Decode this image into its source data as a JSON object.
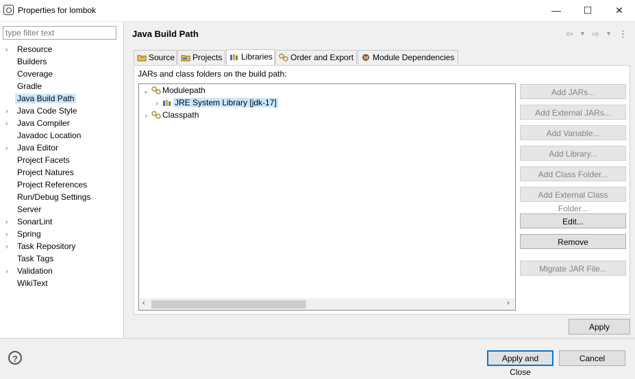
{
  "window": {
    "title": "Properties for lombok",
    "minimize_glyph": "—",
    "maximize_glyph": "☐",
    "close_glyph": "✕"
  },
  "filter": {
    "placeholder": "type filter text",
    "value": ""
  },
  "nav": {
    "items": [
      {
        "label": "Resource",
        "expandable": true
      },
      {
        "label": "Builders",
        "expandable": false
      },
      {
        "label": "Coverage",
        "expandable": false
      },
      {
        "label": "Gradle",
        "expandable": false
      },
      {
        "label": "Java Build Path",
        "expandable": false,
        "selected": true
      },
      {
        "label": "Java Code Style",
        "expandable": true
      },
      {
        "label": "Java Compiler",
        "expandable": true
      },
      {
        "label": "Javadoc Location",
        "expandable": false
      },
      {
        "label": "Java Editor",
        "expandable": true
      },
      {
        "label": "Project Facets",
        "expandable": false
      },
      {
        "label": "Project Natures",
        "expandable": false
      },
      {
        "label": "Project References",
        "expandable": false
      },
      {
        "label": "Run/Debug Settings",
        "expandable": false
      },
      {
        "label": "Server",
        "expandable": false
      },
      {
        "label": "SonarLint",
        "expandable": true
      },
      {
        "label": "Spring",
        "expandable": true
      },
      {
        "label": "Task Repository",
        "expandable": true
      },
      {
        "label": "Task Tags",
        "expandable": false
      },
      {
        "label": "Validation",
        "expandable": true
      },
      {
        "label": "WikiText",
        "expandable": false
      }
    ]
  },
  "page": {
    "title": "Java Build Path",
    "back_glyph": "⇦",
    "forward_glyph": "⇨",
    "menu_glyph": "⋮"
  },
  "tabs": [
    {
      "label": "Source",
      "icon": "source-folder-icon"
    },
    {
      "label": "Projects",
      "icon": "projects-icon"
    },
    {
      "label": "Libraries",
      "icon": "libraries-icon",
      "active": true
    },
    {
      "label": "Order and Export",
      "icon": "order-export-icon"
    },
    {
      "label": "Module Dependencies",
      "icon": "module-dependencies-icon"
    }
  ],
  "libraries": {
    "heading": "JARs and class folders on the build path:",
    "tree": [
      {
        "label": "Modulepath",
        "expanded": true,
        "depth": 0
      },
      {
        "label": "JRE System Library [jdk-17]",
        "expanded": false,
        "depth": 1,
        "selected": true
      },
      {
        "label": "Classpath",
        "expanded": false,
        "depth": 0
      }
    ],
    "buttons": [
      {
        "label": "Add JARs...",
        "enabled": false
      },
      {
        "label": "Add External JARs...",
        "enabled": false
      },
      {
        "label": "Add Variable...",
        "enabled": false
      },
      {
        "label": "Add Library...",
        "enabled": false
      },
      {
        "label": "Add Class Folder...",
        "enabled": false
      },
      {
        "label": "Add External Class Folder...",
        "enabled": false
      },
      {
        "label": "Edit...",
        "enabled": true
      },
      {
        "label": "Remove",
        "enabled": true
      },
      {
        "label": "Migrate JAR File...",
        "enabled": false
      }
    ],
    "apply_label": "Apply"
  },
  "footer": {
    "help_glyph": "?",
    "apply_close_label": "Apply and Close",
    "cancel_label": "Cancel"
  },
  "colors": {
    "selection": "#cce8ff",
    "default_button_border": "#0078d7"
  }
}
